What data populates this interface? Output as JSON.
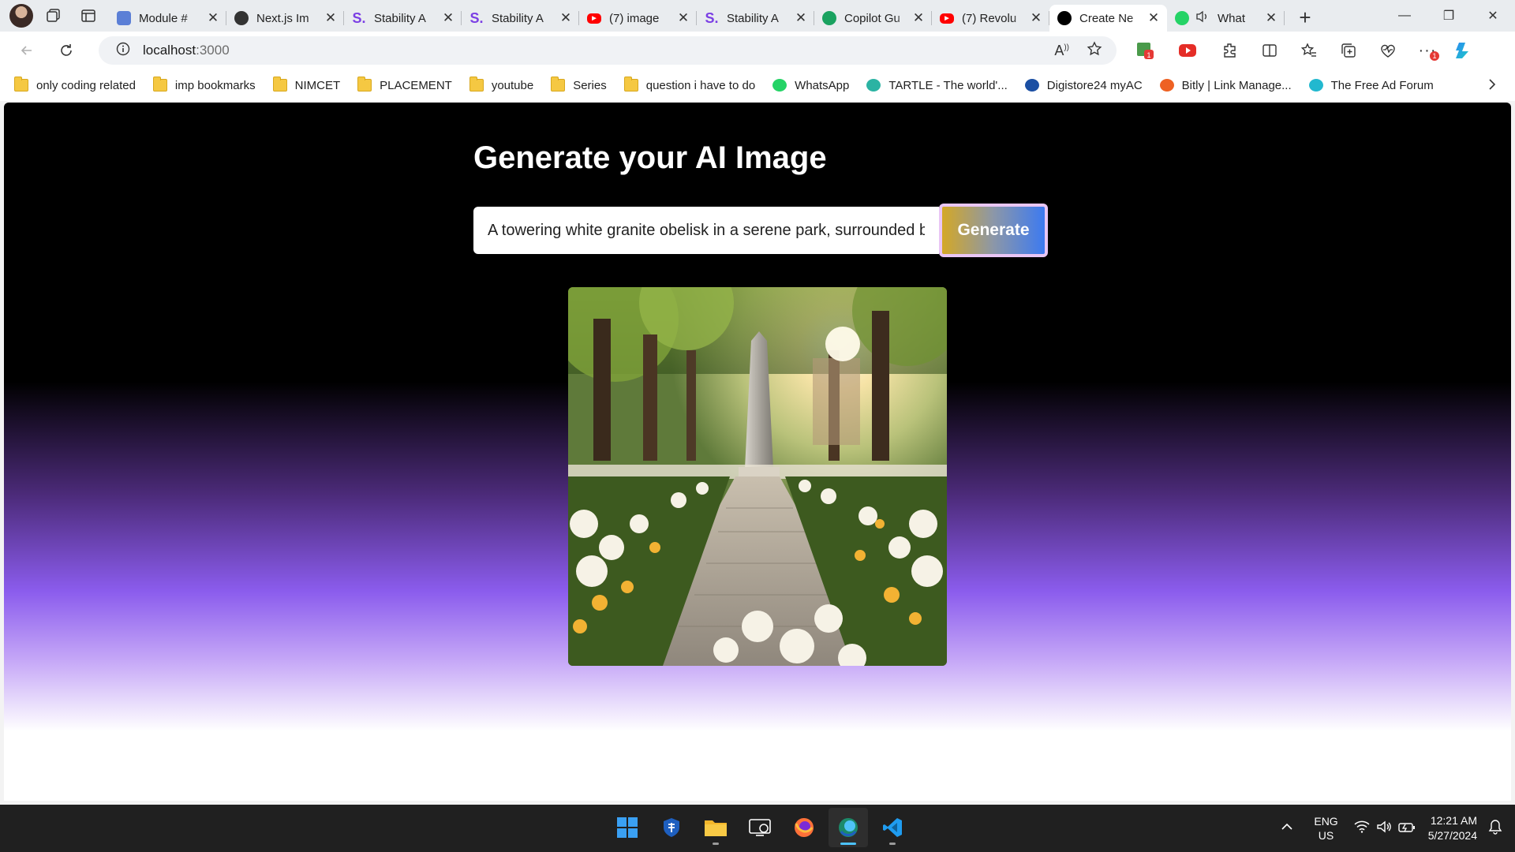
{
  "browser": {
    "tabs": [
      {
        "title": "Module #",
        "favicon": "module-icon",
        "color": "#5b7fd6",
        "active": false
      },
      {
        "title": "Next.js Im",
        "favicon": "openai-icon",
        "color": "#333333",
        "active": false
      },
      {
        "title": "Stability A",
        "favicon": "stability-icon",
        "color": "#7b3fe4",
        "active": false
      },
      {
        "title": "Stability A",
        "favicon": "stability-icon",
        "color": "#7b3fe4",
        "active": false
      },
      {
        "title": "(7) image",
        "favicon": "youtube-icon",
        "color": "#ff0000",
        "active": false
      },
      {
        "title": "Stability A",
        "favicon": "stability-icon",
        "color": "#7b3fe4",
        "active": false
      },
      {
        "title": "Copilot Gu",
        "favicon": "copilot-icon",
        "color": "#1aa260",
        "active": false
      },
      {
        "title": "(7) Revolu",
        "favicon": "youtube-icon",
        "color": "#ff0000",
        "active": false
      },
      {
        "title": "Create Ne",
        "favicon": "nextjs-icon",
        "color": "#000000",
        "active": true
      },
      {
        "title": "What",
        "favicon": "whatsapp-icon",
        "color": "#25d366",
        "active": false
      }
    ],
    "address": {
      "host": "localhost",
      "port": ":3000"
    },
    "bookmarks": [
      {
        "label": "only coding  related",
        "icon": "folder-icon"
      },
      {
        "label": "imp bookmarks",
        "icon": "folder-icon"
      },
      {
        "label": "NIMCET",
        "icon": "folder-icon"
      },
      {
        "label": "PLACEMENT",
        "icon": "folder-icon"
      },
      {
        "label": "youtube",
        "icon": "folder-icon"
      },
      {
        "label": "Series",
        "icon": "folder-icon"
      },
      {
        "label": "question i have to do",
        "icon": "folder-icon"
      },
      {
        "label": "WhatsApp",
        "icon": "whatsapp-icon",
        "color": "#25d366"
      },
      {
        "label": "TARTLE - The world'...",
        "icon": "tartle-icon",
        "color": "#2bb3a3"
      },
      {
        "label": "Digistore24 myAC",
        "icon": "digistore-icon",
        "color": "#1b4fa3"
      },
      {
        "label": "Bitly | Link Manage...",
        "icon": "bitly-icon",
        "color": "#ee6123"
      },
      {
        "label": "The Free Ad Forum",
        "icon": "adforum-icon",
        "color": "#22b8cf"
      }
    ]
  },
  "app": {
    "title": "Generate your AI Image",
    "prompt_value": "A towering white granite obelisk in a serene park, surrounded by blooming flowers",
    "generate_label": "Generate",
    "image_alt": "obelisk-park-image"
  },
  "taskbar": {
    "apps": [
      "windows-start-icon",
      "defender-icon",
      "file-explorer-icon",
      "remote-desktop-icon",
      "firefox-icon",
      "edge-dev-icon",
      "vscode-icon"
    ],
    "lang_line1": "ENG",
    "lang_line2": "US",
    "time": "12:21 AM",
    "date": "5/27/2024"
  }
}
